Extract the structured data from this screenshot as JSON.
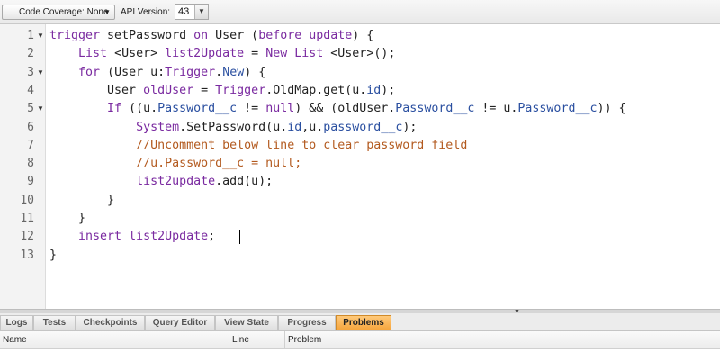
{
  "toolbar": {
    "code_coverage": "Code Coverage: None",
    "api_label": "API Version:",
    "api_version": "43"
  },
  "editor": {
    "line_numbers": [
      "1",
      "2",
      "3",
      "4",
      "5",
      "6",
      "7",
      "8",
      "9",
      "10",
      "11",
      "12",
      "13"
    ],
    "folded_lines": [
      1,
      3,
      5
    ],
    "lines": [
      [
        [
          "trigger",
          "#7a2aa0"
        ],
        [
          " setPassword ",
          "#222"
        ],
        [
          "on",
          "#7a2aa0"
        ],
        [
          " User (",
          "#222"
        ],
        [
          "before",
          "#7a2aa0"
        ],
        [
          " ",
          "#222"
        ],
        [
          "update",
          "#7a2aa0"
        ],
        [
          ") {",
          "#222"
        ]
      ],
      [
        [
          "    ",
          "#222"
        ],
        [
          "List",
          "#7a2aa0"
        ],
        [
          " <User> ",
          "#222"
        ],
        [
          "list2Update",
          "#7a2aa0"
        ],
        [
          " = ",
          "#222"
        ],
        [
          "New",
          "#7a2aa0"
        ],
        [
          " ",
          "#222"
        ],
        [
          "List",
          "#7a2aa0"
        ],
        [
          " <User>();",
          "#222"
        ]
      ],
      [
        [
          "    ",
          "#222"
        ],
        [
          "for",
          "#7a2aa0"
        ],
        [
          " (User u:",
          "#222"
        ],
        [
          "Trigger",
          "#7a2aa0"
        ],
        [
          ".",
          "#222"
        ],
        [
          "New",
          "#2a4fa0"
        ],
        [
          ") {",
          "#222"
        ]
      ],
      [
        [
          "        User ",
          "#222"
        ],
        [
          "oldUser",
          "#7a2aa0"
        ],
        [
          " = ",
          "#222"
        ],
        [
          "Trigger",
          "#7a2aa0"
        ],
        [
          ".OldMap.get(u.",
          "#222"
        ],
        [
          "id",
          "#2a4fa0"
        ],
        [
          ");",
          "#222"
        ]
      ],
      [
        [
          "        ",
          "#222"
        ],
        [
          "If",
          "#7a2aa0"
        ],
        [
          " ((u.",
          "#222"
        ],
        [
          "Password__c",
          "#2a4fa0"
        ],
        [
          " != ",
          "#222"
        ],
        [
          "null",
          "#7a2aa0"
        ],
        [
          ") && (oldUser.",
          "#222"
        ],
        [
          "Password__c",
          "#2a4fa0"
        ],
        [
          " != u.",
          "#222"
        ],
        [
          "Password__c",
          "#2a4fa0"
        ],
        [
          ")) {",
          "#222"
        ]
      ],
      [
        [
          "            ",
          "#222"
        ],
        [
          "System",
          "#7a2aa0"
        ],
        [
          ".SetPassword(u.",
          "#222"
        ],
        [
          "id",
          "#2a4fa0"
        ],
        [
          ",u.",
          "#222"
        ],
        [
          "password__c",
          "#2a4fa0"
        ],
        [
          ");",
          "#222"
        ]
      ],
      [
        [
          "            ",
          "#222"
        ],
        [
          "//Uncomment below line to clear password field",
          "#b35a1f"
        ]
      ],
      [
        [
          "            ",
          "#222"
        ],
        [
          "//u.Password__c = null;",
          "#b35a1f"
        ]
      ],
      [
        [
          "            ",
          "#222"
        ],
        [
          "list2update",
          "#7a2aa0"
        ],
        [
          ".add(u);",
          "#222"
        ]
      ],
      [
        [
          "        }",
          "#222"
        ]
      ],
      [
        [
          "    }",
          "#222"
        ]
      ],
      [
        [
          "    ",
          "#222"
        ],
        [
          "insert",
          "#7a2aa0"
        ],
        [
          " ",
          "#222"
        ],
        [
          "list2Update",
          "#7a2aa0"
        ],
        [
          ";",
          "#222"
        ]
      ],
      [
        [
          "}",
          "#222"
        ]
      ]
    ]
  },
  "tabs": [
    {
      "label": "Logs",
      "active": false
    },
    {
      "label": "Tests",
      "active": false
    },
    {
      "label": "Checkpoints",
      "active": false
    },
    {
      "label": "Query Editor",
      "active": false
    },
    {
      "label": "View State",
      "active": false
    },
    {
      "label": "Progress",
      "active": false
    },
    {
      "label": "Problems",
      "active": true
    }
  ],
  "problems_columns": [
    "Name",
    "Line",
    "Problem"
  ]
}
